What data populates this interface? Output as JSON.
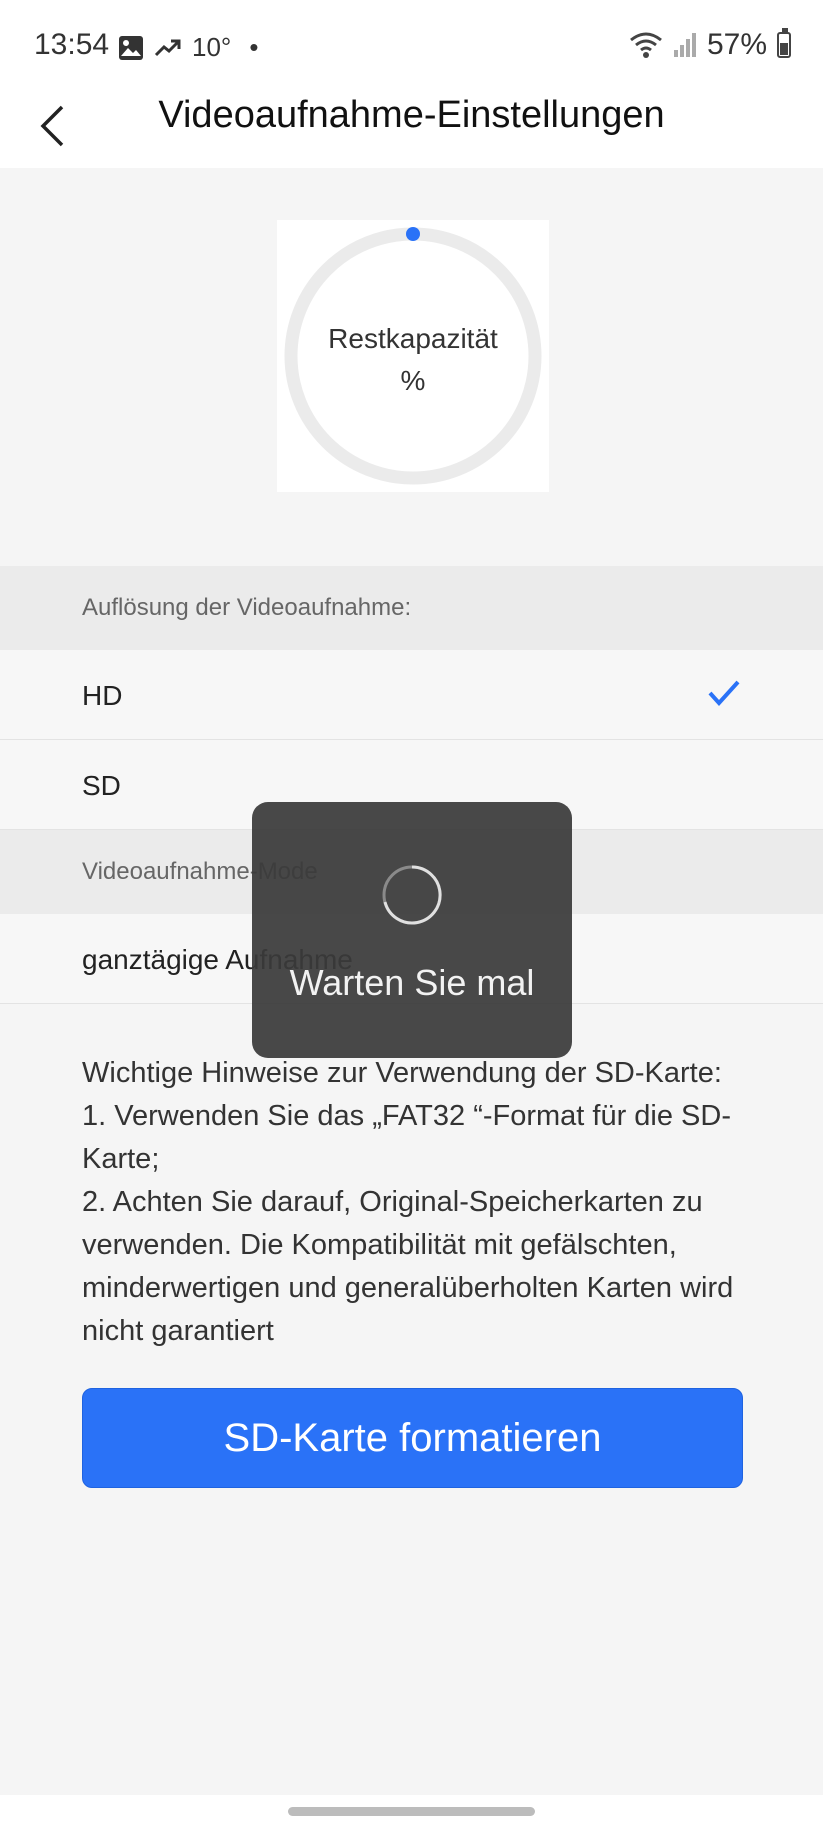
{
  "status_bar": {
    "time": "13:54",
    "temperature": "10°",
    "dot": "•",
    "battery": "57%",
    "icons": [
      "gallery-icon",
      "trending-icon",
      "wifi-icon",
      "signal-icon",
      "battery-icon"
    ]
  },
  "header": {
    "title": "Videoaufnahme-Einstellungen",
    "back_icon": "chevron-left-icon"
  },
  "capacity": {
    "label": "Restkapazität",
    "value_text": "%",
    "fill_fraction": 0.0
  },
  "resolution_section": {
    "header": "Auflösung der Videoaufnahme:",
    "options": [
      {
        "label": "HD",
        "selected": true
      },
      {
        "label": "SD",
        "selected": false
      }
    ]
  },
  "mode_section": {
    "header": "Videoaufnahme-Mode",
    "value": "ganztägige Aufnahme"
  },
  "notes": {
    "line1": "Wichtige Hinweise zur Verwendung der SD-Karte:",
    "line2": "1. Verwenden Sie das „FAT32 “-Format für die SD-Karte;",
    "line3": "2. Achten Sie darauf, Original-Speicherkarten zu verwenden. Die Kompatibilität mit gefälschten, minderwertigen und generalüberholten Karten wird nicht garantiert"
  },
  "format_button": {
    "label": "SD-Karte formatieren"
  },
  "loading": {
    "text": "Warten Sie mal"
  },
  "colors": {
    "accent": "#2a72f7",
    "ring_track": "#ebebeb",
    "toast_bg": "#3a3a3a"
  }
}
